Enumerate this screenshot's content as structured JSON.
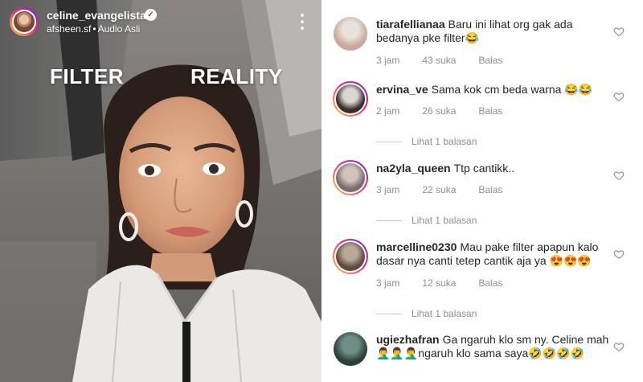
{
  "video": {
    "username": "celine_evangelista",
    "verified_symbol": "✓",
    "source_account": "afsheen.sf",
    "separator": "•",
    "audio": "Audio Asli",
    "label_left": "FILTER",
    "label_right": "REALITY"
  },
  "comments": [
    {
      "username": "tiarafellianaa",
      "text": "Baru ini lihat org gak ada bedanya pke filter😂",
      "time": "3 jam",
      "likes": "43 suka",
      "reply": "Balas",
      "avatar_colors": [
        "#e8e2dc",
        "#caa79a"
      ],
      "story_ring": false,
      "view_replies": ""
    },
    {
      "username": "ervina_ve",
      "text": "Sama kok cm beda warna 😂😂",
      "time": "2 jam",
      "likes": "26 suka",
      "reply": "Balas",
      "avatar_colors": [
        "#d9d6d3",
        "#3b2b25"
      ],
      "story_ring": true,
      "view_replies": "Lihat 1 balasan"
    },
    {
      "username": "na2yla_queen",
      "text": "Ttp cantikk..",
      "time": "3 jam",
      "likes": "22 suka",
      "reply": "Balas",
      "avatar_colors": [
        "#cfc3ba",
        "#7b6a72"
      ],
      "story_ring": true,
      "view_replies": "Lihat 1 balasan"
    },
    {
      "username": "marcelline0230",
      "text": "Mau pake filter apapun kalo dasar nya canti tetep cantik aja ya 😍😍😍",
      "time": "3 jam",
      "likes": "12 suka",
      "reply": "Balas",
      "avatar_colors": [
        "#b9a89a",
        "#5e4a40"
      ],
      "story_ring": true,
      "view_replies": "Lihat 1 balasan"
    },
    {
      "username": "ugiezhafran",
      "text": "Ga ngaruh klo sm ny. Celine mah🤦‍♂️🤦‍♂️🤦‍♂️ngaruh klo sama saya🤣🤣🤣🤣",
      "time": "",
      "likes": "",
      "reply": "",
      "avatar_colors": [
        "#6f8f86",
        "#2c3f3a"
      ],
      "story_ring": false,
      "view_replies": ""
    }
  ],
  "colors": {
    "username_text": "#262626",
    "meta_text": "#8e8e8e",
    "heart_outline": "#8e8e8e"
  },
  "icons": {
    "verified": "verified-badge-icon",
    "more": "more-vertical-icon",
    "like": "heart-outline-icon"
  }
}
